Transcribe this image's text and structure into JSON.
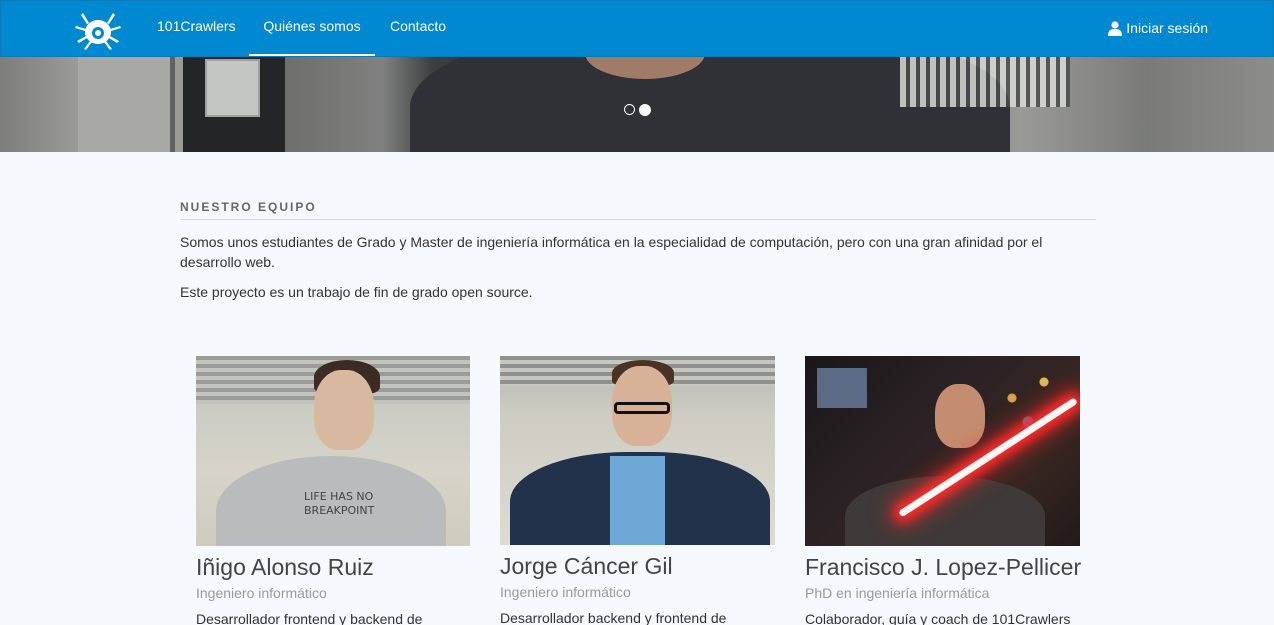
{
  "nav": {
    "brand": "101Crawlers",
    "links": [
      {
        "label": "101Crawlers"
      },
      {
        "label": "Quiénes somos",
        "active": true
      },
      {
        "label": "Contacto"
      }
    ],
    "login_label": "Iniciar sesión",
    "login_icon": "user-icon",
    "color": "#0088d1"
  },
  "carousel": {
    "slides": 2,
    "active_slide": 2
  },
  "team": {
    "title": "NUESTRO EQUIPO",
    "intro": "Somos unos estudiantes de Grado y Master de ingeniería informática en la especialidad de computación, pero con una gran afinidad por el desarrollo web.",
    "intro2": "Este proyecto es un trabajo de fin de grado open source.",
    "members": [
      {
        "name": "Iñigo Alonso Ruiz",
        "role": "Ingeniero informático",
        "desc": "Desarrollador frontend y backend de",
        "shirt_text": "LIFE HAS NO BREAKPOINT"
      },
      {
        "name": "Jorge Cáncer Gil",
        "role": "Ingeniero informático",
        "desc": "Desarrollador backend y frontend de"
      },
      {
        "name": "Francisco J. Lopez-Pellicer",
        "role": "PhD en ingeniería informática",
        "desc": "Colaborador, guía y coach de 101Crawlers"
      }
    ]
  }
}
